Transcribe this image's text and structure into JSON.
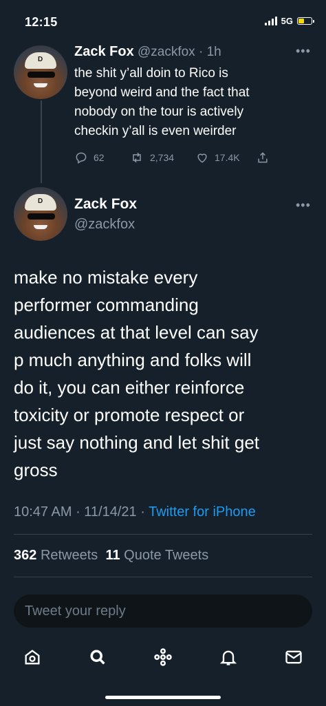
{
  "status_bar": {
    "time": "12:15",
    "network": "5G"
  },
  "parent_tweet": {
    "display_name": "Zack Fox",
    "handle": "@zackfox",
    "time_ago": "1h",
    "lines": [
      "the shit y’all doin to Rico is",
      "beyond weird and the fact that",
      "nobody on the tour is actively",
      "checkin y’all is even weirder"
    ],
    "replies": "62",
    "retweets": "2,734",
    "likes": "17.4K"
  },
  "main_tweet": {
    "display_name": "Zack Fox",
    "handle": "@zackfox",
    "lines": [
      "make no mistake every",
      "performer commanding",
      "audiences at that level can say",
      "p much anything and folks will",
      "do it, you can either reinforce",
      "toxicity or promote respect or",
      "just say nothing and let shit get",
      "gross"
    ],
    "time": "10:47 AM",
    "date": "11/14/21",
    "source": "Twitter for iPhone",
    "retweet_count": "362",
    "retweet_label": "Retweets",
    "quote_count": "11",
    "quote_label": "Quote Tweets"
  },
  "reply_placeholder": "Tweet your reply",
  "tabbar": {
    "icons": [
      "home-icon",
      "search-icon",
      "spaces-icon",
      "notifications-icon",
      "messages-icon"
    ]
  },
  "colors": {
    "background": "#15202b",
    "accent": "#1d9bf0",
    "muted": "#8b98a5",
    "battery": "#f5d90a"
  }
}
